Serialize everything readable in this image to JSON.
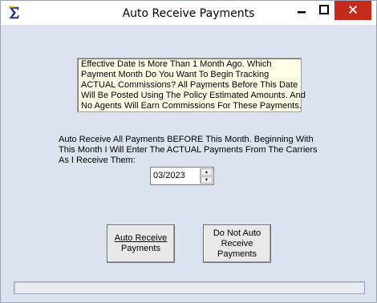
{
  "window": {
    "title": "Auto Receive Payments",
    "icon": "sigma-icon",
    "controls": [
      "minimize-icon",
      "maximize-icon",
      "close-icon"
    ],
    "close_color": "#c42b1c"
  },
  "memo": {
    "lines": [
      "Effective Date Is More Than 1 Month Ago. Which",
      "Payment Month Do You Want To Begin Tracking",
      "ACTUAL Commissions? All Payments Before This Date",
      "Will Be Posted Using The Policy Estimated Amounts. And",
      "No Agents Will Earn Commissions For These Payments."
    ]
  },
  "prompt": {
    "lines": [
      "Auto Receive All Payments BEFORE This Month. Beginning With",
      "This Month I Will Enter The ACTUAL Payments From The Carriers",
      "As I Receive Them:"
    ]
  },
  "month_field": {
    "value": "03/2023"
  },
  "buttons": {
    "auto_receive": {
      "line1": "Auto Receive",
      "line2": "Payments"
    },
    "do_not_auto": {
      "line1": "Do Not Auto",
      "line2": "Receive",
      "line3": "Payments"
    }
  }
}
